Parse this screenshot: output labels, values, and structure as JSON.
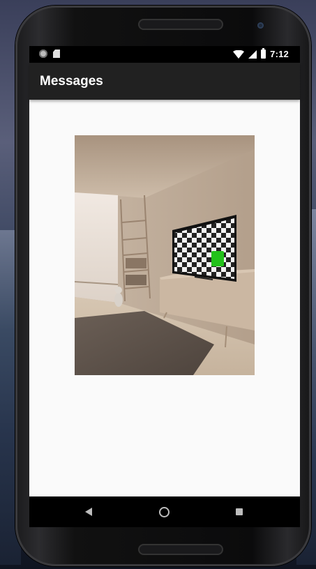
{
  "status_bar": {
    "time": "7:12",
    "icons": [
      "notification-circle-icon",
      "sd-card-icon",
      "wifi-icon",
      "cell-signal-icon",
      "battery-charging-icon"
    ]
  },
  "app_bar": {
    "title": "Messages"
  },
  "content": {
    "image_description_icon": "room-with-tv-photo",
    "tv_screen_pattern": "checkerboard",
    "marker_color": "#22c21a"
  },
  "nav_bar": {
    "icons": [
      "back-icon",
      "home-icon",
      "recents-icon"
    ]
  },
  "colors": {
    "app_bar_bg": "#212121",
    "content_bg": "#fafafa",
    "status_bar_bg": "#000000"
  }
}
